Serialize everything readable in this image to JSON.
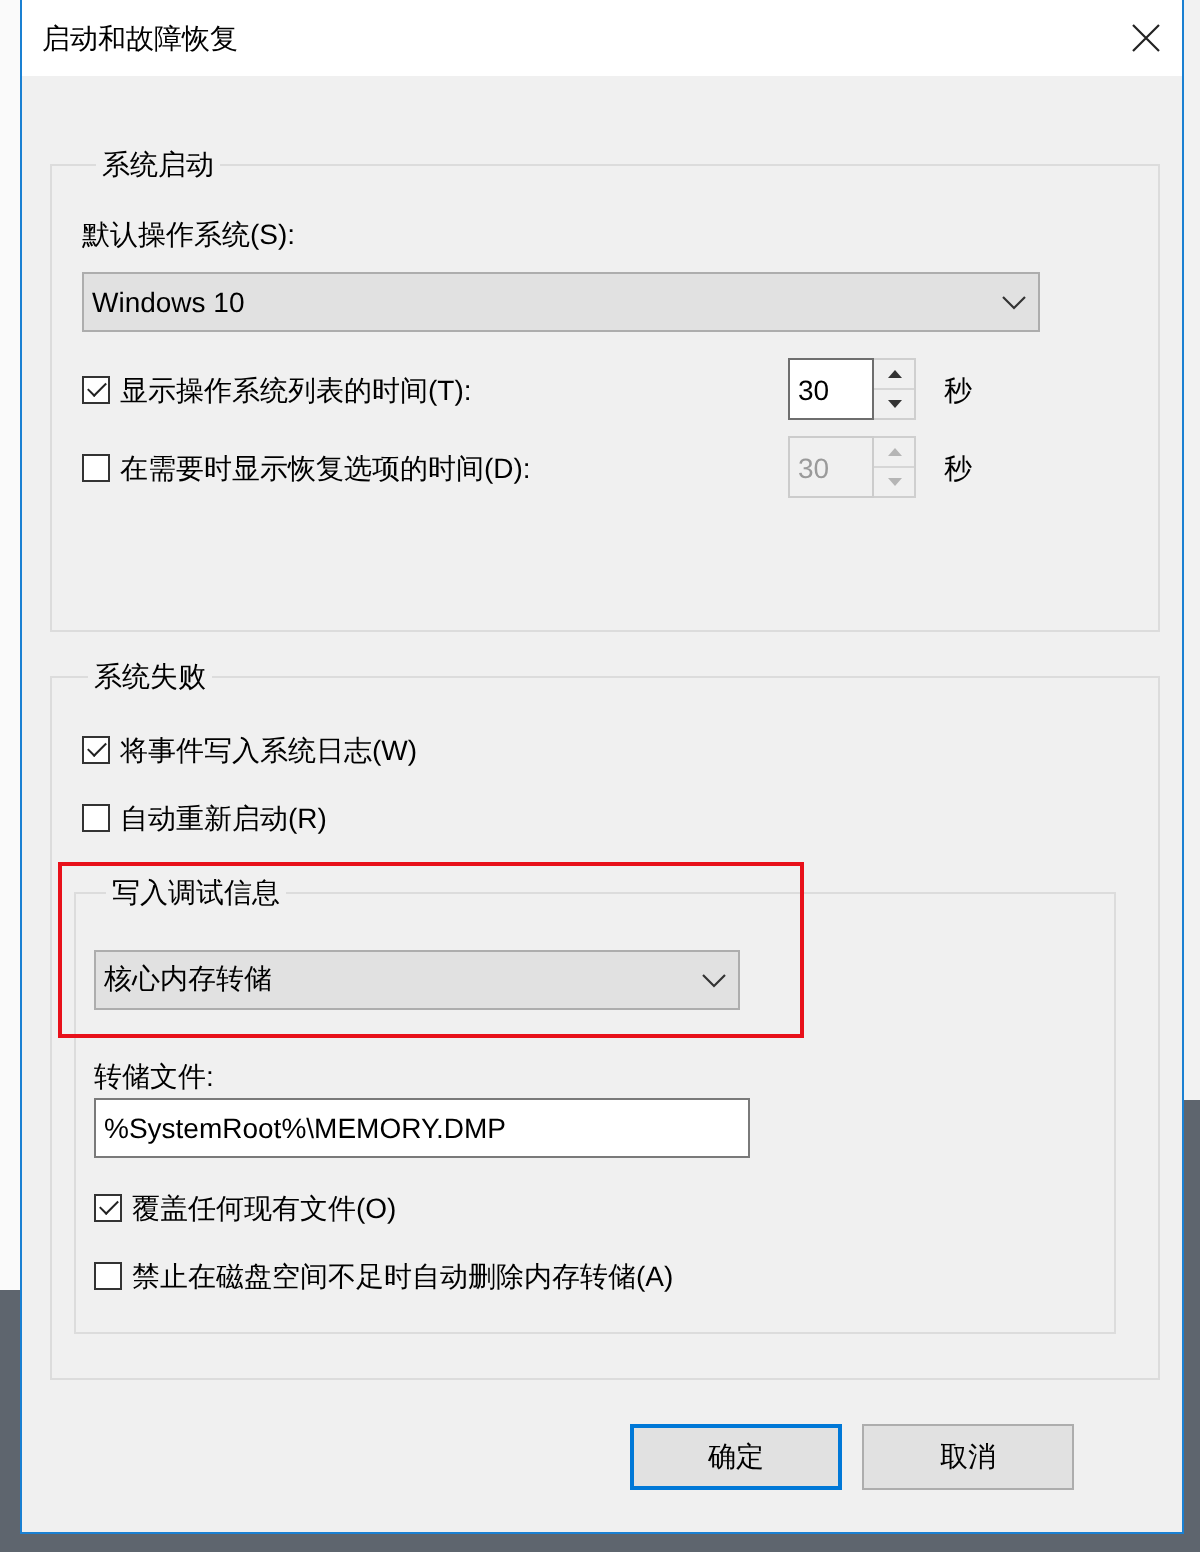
{
  "window": {
    "title": "启动和故障恢复"
  },
  "system_startup": {
    "title": "系统启动",
    "default_os_label": "默认操作系统(S):",
    "default_os": {
      "value": "Windows 10"
    },
    "timeouts": [
      {
        "label": "显示操作系统列表的时间(T):",
        "checked": true,
        "value": "30",
        "disabled": false,
        "unit": "秒"
      },
      {
        "label": "在需要时显示恢复选项的时间(D):",
        "checked": false,
        "value": "30",
        "disabled": true,
        "unit": "秒"
      }
    ]
  },
  "system_failure": {
    "title": "系统失败",
    "options": [
      {
        "label": "将事件写入系统日志(W)",
        "checked": true
      },
      {
        "label": "自动重新启动(R)",
        "checked": false
      }
    ],
    "debug_info": {
      "title": "写入调试信息",
      "highlighted": true,
      "dump_type": {
        "value": "核心内存转储"
      },
      "dump_file_label": "转储文件:",
      "dump_file": {
        "value": "%SystemRoot%\\MEMORY.DMP"
      },
      "options": [
        {
          "label": "覆盖任何现有文件(O)",
          "checked": true
        },
        {
          "label": "禁止在磁盘空间不足时自动删除内存转储(A)",
          "checked": false
        }
      ]
    }
  },
  "buttons": [
    {
      "label": "确定",
      "default": true
    },
    {
      "label": "取消",
      "default": false
    }
  ]
}
